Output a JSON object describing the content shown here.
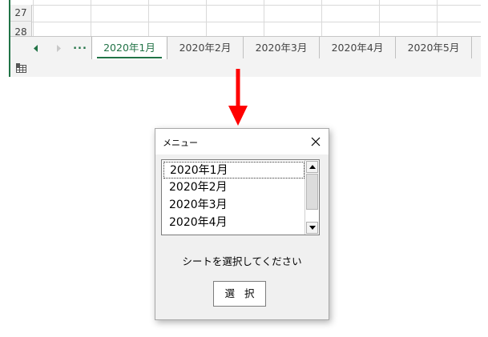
{
  "excel": {
    "rows": [
      "27",
      "28"
    ],
    "sheet_tabs": [
      "2020年1月",
      "2020年2月",
      "2020年3月",
      "2020年4月",
      "2020年5月"
    ],
    "active_tab_index": 0,
    "more_tabs_label": "...",
    "accent_color": "#217346"
  },
  "dialog": {
    "title": "メニュー",
    "list_items": [
      "2020年1月",
      "2020年2月",
      "2020年3月",
      "2020年4月"
    ],
    "selected_index": 0,
    "message": "シートを選択してください",
    "select_button_label": "選 択"
  },
  "arrow_color": "#ff0000"
}
